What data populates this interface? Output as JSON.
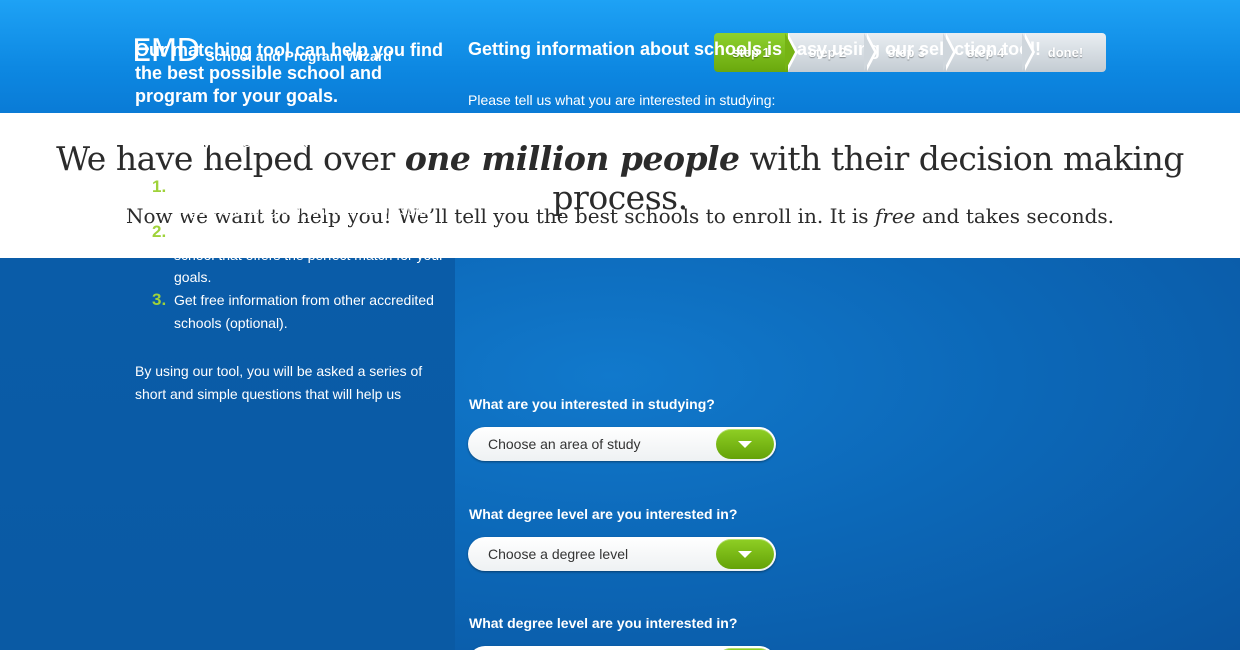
{
  "header": {
    "logo_mark": "EMD",
    "logo_text": "School and Program Wizard",
    "steps": [
      {
        "label": "step 1",
        "active": true
      },
      {
        "label": "step 2",
        "active": false
      },
      {
        "label": "step 3",
        "active": false
      },
      {
        "label": "step 4",
        "active": false
      },
      {
        "label": "done!",
        "active": false
      }
    ]
  },
  "hero": {
    "title_before": "We have helped over ",
    "title_emphasis": "one million people",
    "title_after": " with their decision making process.",
    "sub_before": "Now we want to help you! We’ll tell you the best schools to enroll in. It is ",
    "sub_emphasis": "free",
    "sub_after": " and takes seconds."
  },
  "left_panel": {
    "heading": "Our matching tool can help you find the best possible school and program for your goals.",
    "subheading": "Just 3 easy steps and you’ll be on your way:",
    "steps": [
      {
        "num": "1.",
        "text": "Tell us about yourself. Let us know the degree and program you want to pursue."
      },
      {
        "num": "2.",
        "text": "Research and receive information from the school that offers the perfect match for your goals."
      },
      {
        "num": "3.",
        "text": "Get free information from other accredited schools (optional)."
      }
    ],
    "footer": "By using our tool, you will be asked a series of short and simple questions that will help us"
  },
  "right_panel": {
    "heading": "Getting information about schools is easy using our selection tool!",
    "intro": "Please tell us what you are interested in studying:",
    "questions": [
      {
        "label": "What are you interested in studying?",
        "value": "Choose an area of study"
      },
      {
        "label": "What degree level are you interested in?",
        "value": "Choose a degree level"
      },
      {
        "label": "What degree level are you interested in?",
        "value": ""
      }
    ]
  },
  "colors": {
    "header_blue": "#0d88e2",
    "accent_green": "#76b414",
    "panel_blue": "#0a5ca8"
  }
}
